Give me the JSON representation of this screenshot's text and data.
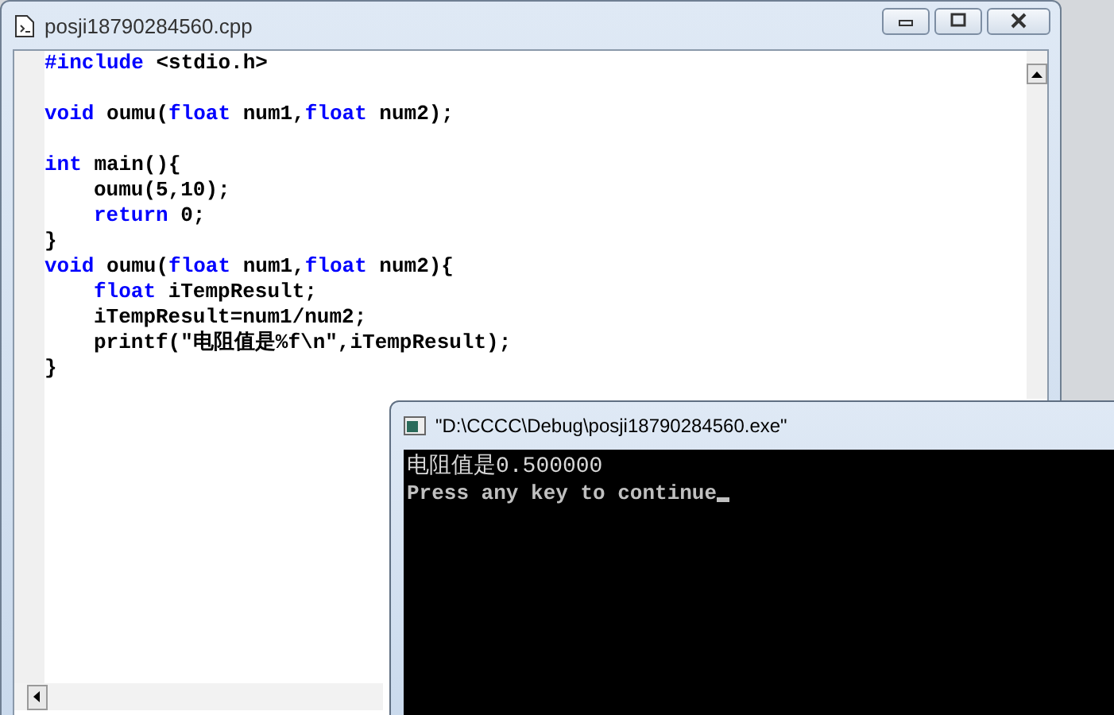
{
  "editor": {
    "title": "posji18790284560.cpp",
    "lines": [
      {
        "kind": "code",
        "segments": [
          {
            "kind": "keyword",
            "text": "#include"
          },
          {
            "kind": "plain",
            "text": " <stdio.h>"
          }
        ]
      },
      {
        "kind": "blank"
      },
      {
        "kind": "code",
        "segments": [
          {
            "kind": "keyword",
            "text": "void"
          },
          {
            "kind": "plain",
            "text": " oumu("
          },
          {
            "kind": "keyword",
            "text": "float"
          },
          {
            "kind": "plain",
            "text": " num1,"
          },
          {
            "kind": "keyword",
            "text": "float"
          },
          {
            "kind": "plain",
            "text": " num2);"
          }
        ]
      },
      {
        "kind": "blank"
      },
      {
        "kind": "code",
        "segments": [
          {
            "kind": "keyword",
            "text": "int"
          },
          {
            "kind": "plain",
            "text": " main(){"
          }
        ]
      },
      {
        "kind": "code",
        "indented": true,
        "segments": [
          {
            "kind": "plain",
            "text": "oumu(5,10);"
          }
        ]
      },
      {
        "kind": "code",
        "indented": true,
        "segments": [
          {
            "kind": "keyword",
            "text": "return"
          },
          {
            "kind": "plain",
            "text": " 0;"
          }
        ]
      },
      {
        "kind": "code",
        "segments": [
          {
            "kind": "plain",
            "text": "}"
          }
        ]
      },
      {
        "kind": "code",
        "segments": [
          {
            "kind": "keyword",
            "text": "void"
          },
          {
            "kind": "plain",
            "text": " oumu("
          },
          {
            "kind": "keyword",
            "text": "float"
          },
          {
            "kind": "plain",
            "text": " num1,"
          },
          {
            "kind": "keyword",
            "text": "float"
          },
          {
            "kind": "plain",
            "text": " num2){"
          }
        ]
      },
      {
        "kind": "code",
        "indented": true,
        "segments": [
          {
            "kind": "keyword",
            "text": "float"
          },
          {
            "kind": "plain",
            "text": " iTempResult;"
          }
        ]
      },
      {
        "kind": "code",
        "indented": true,
        "segments": [
          {
            "kind": "plain",
            "text": "iTempResult=num1/num2;"
          }
        ]
      },
      {
        "kind": "code",
        "indented": true,
        "segments": [
          {
            "kind": "plain",
            "text": "printf(\"电阻值是%f\\n\",iTempResult);"
          }
        ]
      },
      {
        "kind": "code",
        "segments": [
          {
            "kind": "plain",
            "text": "}"
          }
        ]
      }
    ]
  },
  "console": {
    "title": "\"D:\\CCCC\\Debug\\posji18790284560.exe\"",
    "lines": [
      "电阻值是0.500000",
      "Press any key to continue"
    ]
  }
}
